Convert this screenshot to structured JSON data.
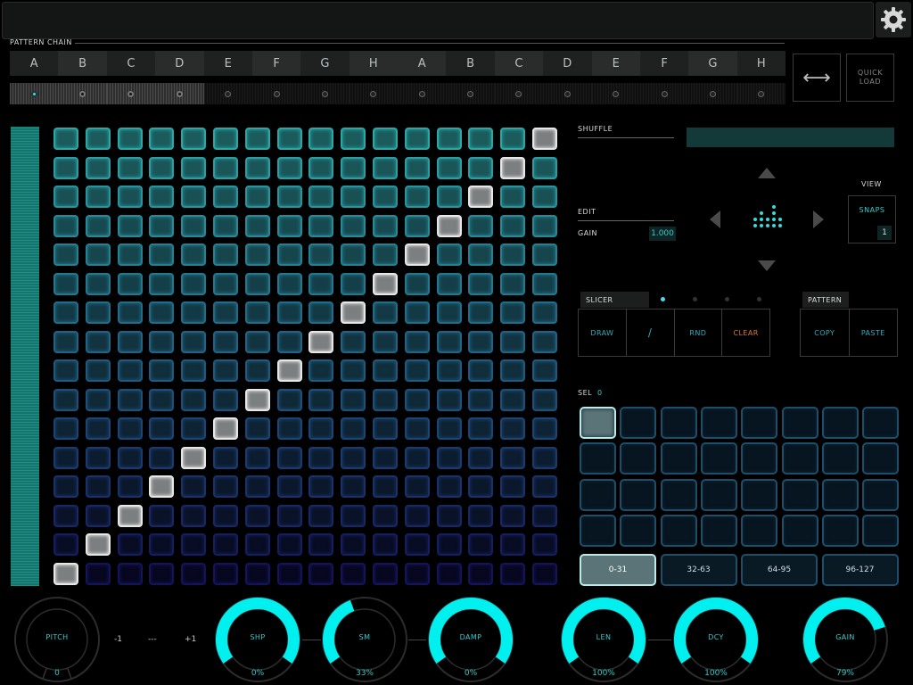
{
  "header": {
    "settings_icon": "gear-icon"
  },
  "pattern_chain": {
    "label": "PATTERN CHAIN",
    "slots": [
      "A",
      "B",
      "C",
      "D",
      "E",
      "F",
      "G",
      "H",
      "A",
      "B",
      "C",
      "D",
      "E",
      "F",
      "G",
      "H"
    ],
    "active_slots": [
      0,
      1,
      2,
      3
    ],
    "current_slot": 0
  },
  "chain_tools": {
    "swap_icon": "swap-horizontal-icon",
    "quick_load": "QUICK LOAD"
  },
  "steps": {
    "rows": 16,
    "cols": 16,
    "selected": [
      15,
      14,
      13,
      12,
      11,
      10,
      9,
      8,
      7,
      6,
      5,
      4,
      3,
      2,
      1,
      0
    ]
  },
  "shuffle": {
    "label": "SHUFFLE"
  },
  "edit": {
    "label": "EDIT",
    "gain_label": "GAIN",
    "gain_value": "1.000"
  },
  "view": {
    "label": "VIEW",
    "mode": "SNAPS",
    "value": "1"
  },
  "slicer": {
    "tab": "SLICER",
    "buttons": [
      "DRAW",
      "/",
      "RND",
      "CLEAR"
    ],
    "page_dots": 4,
    "active_dot": 0
  },
  "pattern": {
    "tab": "PATTERN",
    "buttons": [
      "COPY",
      "PASTE"
    ]
  },
  "selection": {
    "label": "SEL",
    "value": "0"
  },
  "bank": {
    "rows": 4,
    "cols": 8,
    "selected": 0,
    "ranges": [
      "0-31",
      "32-63",
      "64-95",
      "96-127"
    ],
    "selected_range": 0
  },
  "pitch": {
    "label": "PITCH",
    "value": "0",
    "minus": "-1",
    "reset": "---",
    "plus": "+1"
  },
  "knobs": [
    {
      "label": "SHP",
      "value": "0%",
      "level": 1.0
    },
    {
      "label": "SM",
      "value": "33%",
      "level": 0.42
    },
    {
      "label": "DAMP",
      "value": "0%",
      "level": 1.0
    },
    {
      "label": "LEN",
      "value": "100%",
      "level": 1.0
    },
    {
      "label": "DCY",
      "value": "100%",
      "level": 1.0
    },
    {
      "label": "GAIN",
      "value": "79%",
      "level": 0.79
    }
  ],
  "colors": {
    "accent": "#00f0f0",
    "step_top": "#2aa8a8",
    "step_bottom": "#14145a",
    "selected": "#e6e8e8"
  }
}
